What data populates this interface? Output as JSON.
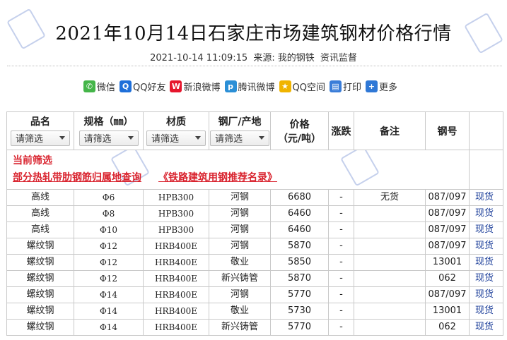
{
  "article": {
    "title": "2021年10月14日石家庄市场建筑钢材价格行情",
    "datetime": "2021-10-14 11:09:15",
    "source_label": "来源:",
    "source_name": "我的钢铁",
    "category": "资讯监督"
  },
  "share": [
    {
      "icon": "wechat-icon",
      "label": "微信",
      "color": "#44b549",
      "glyph": "✆"
    },
    {
      "icon": "qq-friend-icon",
      "label": "QQ好友",
      "color": "#1e6fd9",
      "glyph": "Q"
    },
    {
      "icon": "sina-weibo-icon",
      "label": "新浪微博",
      "color": "#e6162d",
      "glyph": "W"
    },
    {
      "icon": "tencent-weibo-icon",
      "label": "腾讯微博",
      "color": "#2b8fd6",
      "glyph": "p"
    },
    {
      "icon": "qzone-icon",
      "label": "QQ空间",
      "color": "#f0b400",
      "glyph": "★"
    },
    {
      "icon": "print-icon",
      "label": "打印",
      "color": "#3a7dd8",
      "glyph": "▤"
    },
    {
      "icon": "more-icon",
      "label": "更多",
      "color": "#2f78d6",
      "glyph": "+"
    }
  ],
  "table": {
    "headers": {
      "name": "品名",
      "spec": "规格（㎜）",
      "material": "材质",
      "mill": "钢厂/产地",
      "price_line1": "价格",
      "price_line2": "（元/吨）",
      "change": "涨跌",
      "note": "备注",
      "steel_no": "钢号"
    },
    "filter_placeholder": "请筛选",
    "filter": {
      "title": "当前筛选",
      "link1": "部分热轧带肋钢筋归属地查询",
      "link2": "《铁路建筑用钢推荐名录》"
    },
    "rows": [
      {
        "name": "高线",
        "spec": "Φ6",
        "material": "HPB300",
        "mill": "河钢",
        "price": "6680",
        "change": "-",
        "note": "无货",
        "steel_no": "087/097",
        "action": "现货"
      },
      {
        "name": "高线",
        "spec": "Φ8",
        "material": "HPB300",
        "mill": "河钢",
        "price": "6460",
        "change": "-",
        "note": "",
        "steel_no": "087/097",
        "action": "现货"
      },
      {
        "name": "高线",
        "spec": "Φ10",
        "material": "HPB300",
        "mill": "河钢",
        "price": "6460",
        "change": "-",
        "note": "",
        "steel_no": "087/097",
        "action": "现货"
      },
      {
        "name": "螺纹钢",
        "spec": "Φ12",
        "material": "HRB400E",
        "mill": "河钢",
        "price": "5870",
        "change": "-",
        "note": "",
        "steel_no": "087/097",
        "action": "现货"
      },
      {
        "name": "螺纹钢",
        "spec": "Φ12",
        "material": "HRB400E",
        "mill": "敬业",
        "price": "5850",
        "change": "-",
        "note": "",
        "steel_no": "13001",
        "action": "现货"
      },
      {
        "name": "螺纹钢",
        "spec": "Φ12",
        "material": "HRB400E",
        "mill": "新兴铸管",
        "price": "5870",
        "change": "-",
        "note": "",
        "steel_no": "062",
        "action": "现货"
      },
      {
        "name": "螺纹钢",
        "spec": "Φ14",
        "material": "HRB400E",
        "mill": "河钢",
        "price": "5770",
        "change": "-",
        "note": "",
        "steel_no": "087/097",
        "action": "现货"
      },
      {
        "name": "螺纹钢",
        "spec": "Φ14",
        "material": "HRB400E",
        "mill": "敬业",
        "price": "5730",
        "change": "-",
        "note": "",
        "steel_no": "13001",
        "action": "现货"
      },
      {
        "name": "螺纹钢",
        "spec": "Φ14",
        "material": "HRB400E",
        "mill": "新兴铸管",
        "price": "5770",
        "change": "-",
        "note": "",
        "steel_no": "062",
        "action": "现货"
      }
    ]
  }
}
